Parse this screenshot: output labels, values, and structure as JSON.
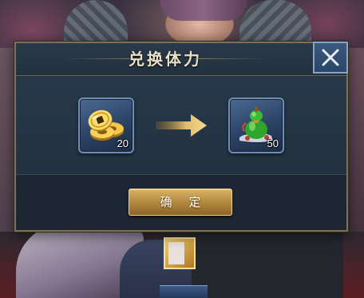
{
  "dialog": {
    "title": "兑换体力",
    "close_icon": "close-icon"
  },
  "exchange": {
    "from": {
      "icon": "gold-coins-icon",
      "count": "20"
    },
    "arrow_icon": "arrow-right-icon",
    "to": {
      "icon": "green-gourd-icon",
      "count": "50"
    }
  },
  "footer": {
    "confirm_label": "确 定"
  },
  "colors": {
    "accent_gold": "#d9b064",
    "dialog_bg": "#1e2a36",
    "close_button_blue": "#3b5a7e"
  }
}
